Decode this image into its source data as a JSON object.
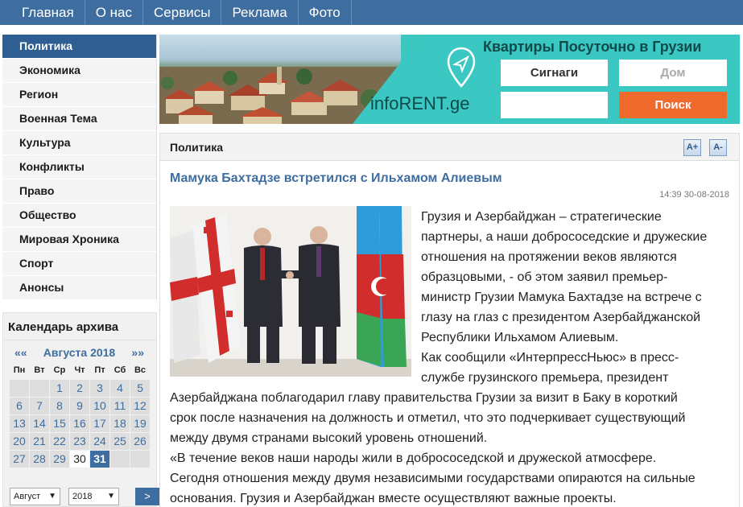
{
  "nav": {
    "items": [
      "Главная",
      "О нас",
      "Сервисы",
      "Реклама",
      "Фото"
    ]
  },
  "sidebar": {
    "items": [
      "Политика",
      "Экономика",
      "Регион",
      "Военная Тема",
      "Культура",
      "Конфликты",
      "Право",
      "Общество",
      "Мировая Хроника",
      "Спорт",
      "Анонсы"
    ],
    "active": "Политика"
  },
  "calendar": {
    "title": "Календарь архива",
    "prev": "««",
    "month_label": "Августа 2018",
    "next": "»»",
    "weekdays": [
      "Пн",
      "Вт",
      "Ср",
      "Чт",
      "Пт",
      "Сб",
      "Вс"
    ],
    "days": [
      "",
      "",
      "1",
      "2",
      "3",
      "4",
      "5",
      "6",
      "7",
      "8",
      "9",
      "10",
      "11",
      "12",
      "13",
      "14",
      "15",
      "16",
      "17",
      "18",
      "19",
      "20",
      "21",
      "22",
      "23",
      "24",
      "25",
      "26",
      "27",
      "28",
      "29",
      "30",
      "31",
      "",
      ""
    ],
    "month_select": "Август",
    "year_select": "2018",
    "go_label": ">"
  },
  "banner": {
    "title": "Квартиры Посуточно в Грузии",
    "logo": "infoRENT.ge",
    "field1": "Сигнаги",
    "field2_placeholder": "Дом",
    "search_button": "Поиск"
  },
  "article": {
    "category": "Политика",
    "font_up": "A+",
    "font_down": "A-",
    "headline": "Мамука Бахтадзе встретился с Ильхамом Алиевым",
    "date": "14:39 30-08-2018",
    "wrapped_lines": [
      "Грузия и Азербайджан – стратегические",
      "партнеры, а наши добрососедские и дружеские",
      "отношения на протяжении веков являются",
      "образцовыми, - об этом заявил премьер-",
      "министр Грузии Мамука Бахтадзе на встрече с",
      "глазу на глаз с президентом Азербайджанской",
      "Республики Ильхамом Алиевым.",
      "Как сообщили «ИнтерпрессНьюс» в пресс-",
      "службе грузинского премьера, президент"
    ],
    "full_lines": [
      "Азербайджана поблагодарил главу правительства Грузии за визит в Баку в короткий",
      "срок после назначения на должность и отметил, что это подчеркивает существующий",
      "между двумя странами высокий уровень отношений.",
      "«В течение веков наши народы жили в добрососедской и дружеской атмосфере.",
      "Сегодня отношения между двумя независимыми государствами опираются на сильные",
      "основания. Грузия и Азербайджан вместе осуществляют важные проекты."
    ]
  },
  "colors": {
    "nav": "#3e6d9f",
    "active": "#2f5f92",
    "link": "#3e6d9f",
    "banner_teal": "#3cc8c2",
    "search_orange": "#ef6a2d"
  }
}
